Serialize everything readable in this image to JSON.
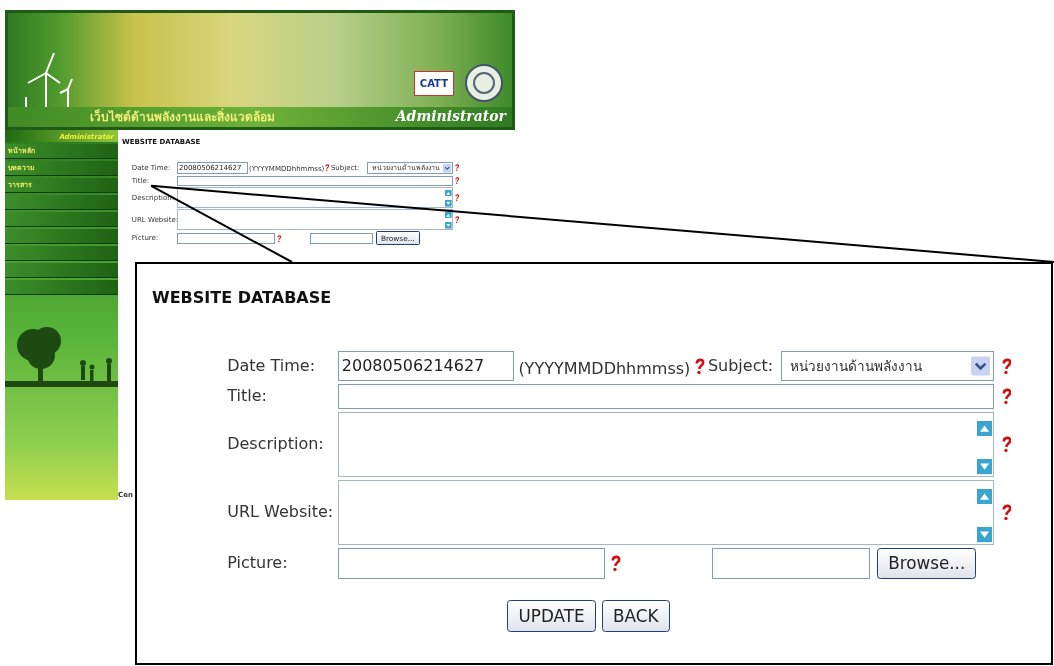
{
  "screenshot": {
    "banner": {
      "tagline": "เว็บไซต์ด้านพลังงานและสิ่งแวดล้อม",
      "logo_text": "CATT",
      "role": "Administrator"
    },
    "sidebar": {
      "title": "Administrator",
      "items": [
        {
          "label": "หน้าหลัก"
        },
        {
          "label": "บทความ"
        },
        {
          "label": "วารสาร"
        }
      ]
    },
    "form": {
      "heading": "WEBSITE DATABASE",
      "rows": [
        {
          "kind": "datetime",
          "label": "Date Time:",
          "value": "20080506214627",
          "hint": "(YYYYMMDDhhmmss)",
          "required": true,
          "extra_label": "Subject:",
          "extra_value": "หน่วยงานด้านพลังงาน",
          "extra_required": true
        },
        {
          "kind": "text",
          "label": "Title:",
          "required": true
        },
        {
          "kind": "textarea",
          "label": "Description:",
          "required": true
        },
        {
          "kind": "textarea",
          "label": "URL Website:",
          "required": true
        },
        {
          "kind": "file",
          "label": "Picture:",
          "required": true,
          "button": "Browse..."
        }
      ]
    },
    "footer": "Cen"
  },
  "enlarged_view": {
    "form": {
      "heading": "WEBSITE DATABASE",
      "rows": [
        {
          "kind": "datetime",
          "label": "Date Time:",
          "value": "20080506214627",
          "hint": "(YYYYMMDDhhmmss)",
          "required": true,
          "extra_label": "Subject:",
          "extra_value": "หน่วยงานด้านพลังงาน",
          "extra_required": true
        },
        {
          "kind": "text",
          "label": "Title:",
          "required": true
        },
        {
          "kind": "textarea",
          "label": "Description:",
          "required": true
        },
        {
          "kind": "textarea",
          "label": "URL Website:",
          "required": true
        },
        {
          "kind": "file",
          "label": "Picture:",
          "required": true,
          "button": "Browse..."
        }
      ],
      "buttons": [
        "UPDATE",
        "BACK"
      ]
    }
  }
}
